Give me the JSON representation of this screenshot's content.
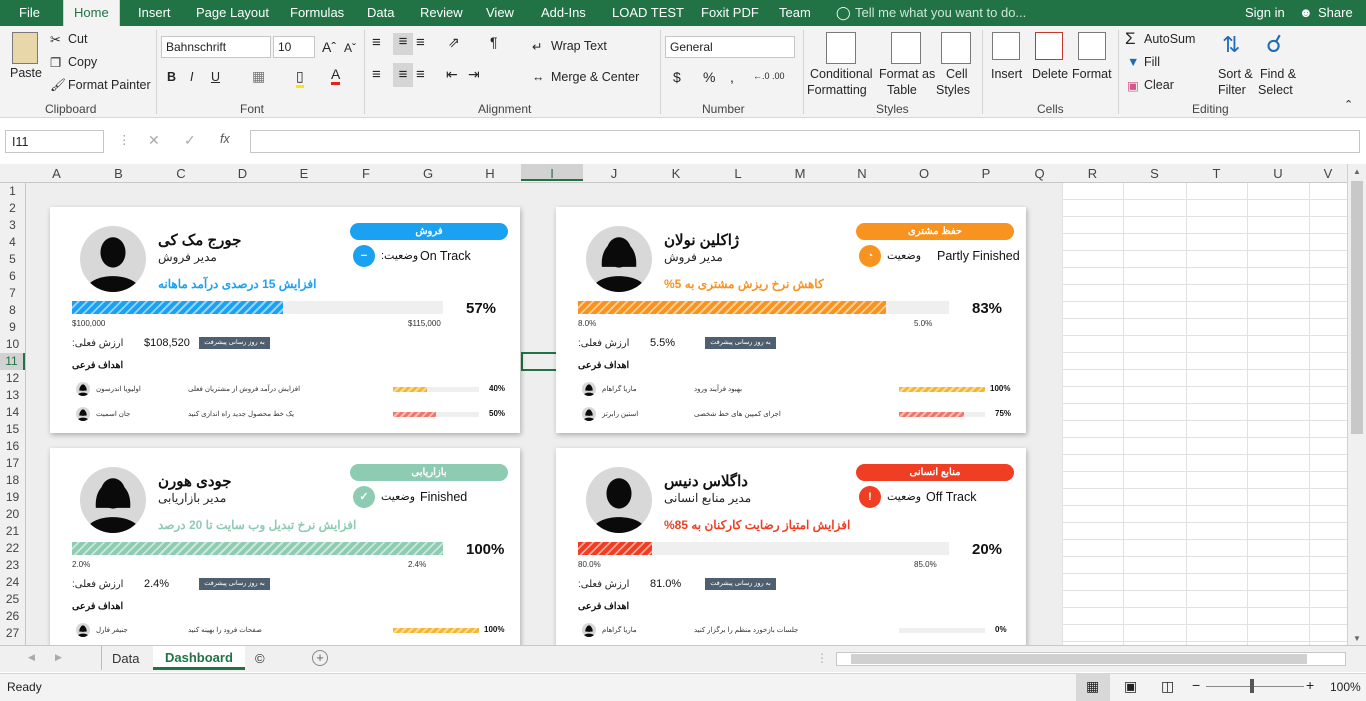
{
  "menu": {
    "file": "File",
    "home": "Home",
    "insert": "Insert",
    "page_layout": "Page Layout",
    "formulas": "Formulas",
    "data": "Data",
    "review": "Review",
    "view": "View",
    "addins": "Add-Ins",
    "load_test": "LOAD TEST",
    "foxit": "Foxit PDF",
    "team": "Team",
    "tell_me": "Tell me what you want to do...",
    "sign_in": "Sign in",
    "share": "Share"
  },
  "ribbon": {
    "clipboard": {
      "paste": "Paste",
      "cut": "Cut",
      "copy": "Copy",
      "format_painter": "Format Painter",
      "group": "Clipboard"
    },
    "font": {
      "name": "Bahnschrift",
      "size": "10",
      "group": "Font",
      "bold": "B",
      "italic": "I",
      "underline": "U"
    },
    "alignment": {
      "wrap": "Wrap Text",
      "merge": "Merge & Center",
      "group": "Alignment"
    },
    "number": {
      "format": "General",
      "group": "Number",
      "currency": "$",
      "percent": "%",
      "comma": ","
    },
    "styles": {
      "cond_1": "Conditional",
      "cond_2": "Formatting",
      "fmt_table_1": "Format as",
      "fmt_table_2": "Table",
      "cell_styles_1": "Cell",
      "cell_styles_2": "Styles",
      "group": "Styles"
    },
    "cells": {
      "insert": "Insert",
      "delete": "Delete",
      "format": "Format",
      "group": "Cells"
    },
    "editing": {
      "autosum": "AutoSum",
      "fill": "Fill",
      "clear": "Clear",
      "sort_1": "Sort &",
      "sort_2": "Filter",
      "find_1": "Find &",
      "find_2": "Select",
      "group": "Editing"
    }
  },
  "formula_bar": {
    "name_box": "I11",
    "fx": "fx",
    "value": ""
  },
  "columns": [
    "A",
    "B",
    "C",
    "D",
    "E",
    "F",
    "G",
    "H",
    "I",
    "J",
    "K",
    "L",
    "M",
    "N",
    "O",
    "P",
    "Q",
    "R",
    "S",
    "T",
    "U",
    "V"
  ],
  "rows": [
    "1",
    "2",
    "3",
    "4",
    "5",
    "6",
    "7",
    "8",
    "9",
    "10",
    "11",
    "12",
    "13",
    "14",
    "15",
    "16",
    "17",
    "18",
    "19",
    "20",
    "21",
    "22",
    "23",
    "24",
    "25",
    "26",
    "27"
  ],
  "cards": [
    {
      "name": "جورج مک کی",
      "role": "مدیر فروش",
      "dept": "فروش",
      "color": "#1ba1f2",
      "status_label": "وضعیت:",
      "status": "On Track",
      "status_icon": "−",
      "goal": "افزایش 15 درصدی درآمد ماهانه",
      "progress": 57,
      "pct_text": "57%",
      "min": "$100,000",
      "max": "$115,000",
      "actual_label": "ارزش فعلی:",
      "actual": "$108,520",
      "update": "به روز رسانی پیشرفت",
      "sub_header": "اهداف فرعی",
      "subs": [
        {
          "name": "اولیویا اندرسون",
          "desc": "افزایش درآمد فروش از مشتریان فعلی",
          "pct": 40,
          "pct_text": "40%",
          "color": "#f5b731"
        },
        {
          "name": "جان اسمیت",
          "desc": "یک خط محصول جدید راه اندازی کنید",
          "pct": 50,
          "pct_text": "50%",
          "color": "#f0766a"
        }
      ]
    },
    {
      "name": "ژاکلین نولان",
      "role": "مدیر فروش",
      "dept": "حفظ مشتری",
      "color": "#f7931e",
      "status_label": "وضعیت",
      "status": "Partly Finished",
      "status_icon": "◔",
      "goal": "کاهش نرخ ریزش مشتری به 5%",
      "progress": 83,
      "pct_text": "83%",
      "min": "8.0%",
      "max": "5.0%",
      "actual_label": "ارزش فعلی:",
      "actual": "5.5%",
      "update": "به روز رسانی پیشرفت",
      "sub_header": "اهداف فرعی",
      "subs": [
        {
          "name": "ماریا گراهام",
          "desc": "بهبود فرآیند ورود",
          "pct": 100,
          "pct_text": "100%",
          "color": "#f5b731"
        },
        {
          "name": "استین رابرتز",
          "desc": "اجرای کمپین های خط شخصی",
          "pct": 75,
          "pct_text": "75%",
          "color": "#f0766a"
        }
      ]
    },
    {
      "name": "جودی هورن",
      "role": "مدیر بازاریابی",
      "dept": "بازاریابی",
      "color": "#8dcbb3",
      "status_label": "وضعیت",
      "status": "Finished",
      "status_icon": "✓",
      "goal": "افزایش نرخ تبدیل وب سایت تا 20 درصد",
      "progress": 100,
      "pct_text": "100%",
      "min": "2.0%",
      "max": "2.4%",
      "actual_label": "ارزش فعلی:",
      "actual": "2.4%",
      "update": "به روز رسانی پیشرفت",
      "sub_header": "اهداف فرعی",
      "subs": [
        {
          "name": "جنیفر فارل",
          "desc": "صفحات فرود را بهینه کنید",
          "pct": 100,
          "pct_text": "100%",
          "color": "#f5b731"
        }
      ]
    },
    {
      "name": "داگلاس دنیس",
      "role": "مدیر منابع انسانی",
      "dept": "منابع انسانی",
      "color": "#ef3e23",
      "status_label": "وضعیت",
      "status": "Off Track",
      "status_icon": "!",
      "goal": "افزایش امتیاز رضایت کارکنان به 85%",
      "progress": 20,
      "pct_text": "20%",
      "min": "80.0%",
      "max": "85.0%",
      "actual_label": "ارزش فعلی:",
      "actual": "81.0%",
      "update": "به روز رسانی پیشرفت",
      "sub_header": "اهداف فرعی",
      "subs": [
        {
          "name": "ماریا گراهام",
          "desc": "جلسات بازخورد منظم را برگزار کنید",
          "pct": 0,
          "pct_text": "0%",
          "color": "#f5b731"
        }
      ]
    }
  ],
  "sheets": {
    "tabs": [
      "Data",
      "Dashboard",
      "©"
    ],
    "active": "Dashboard"
  },
  "status": {
    "ready": "Ready",
    "zoom": "100%"
  }
}
